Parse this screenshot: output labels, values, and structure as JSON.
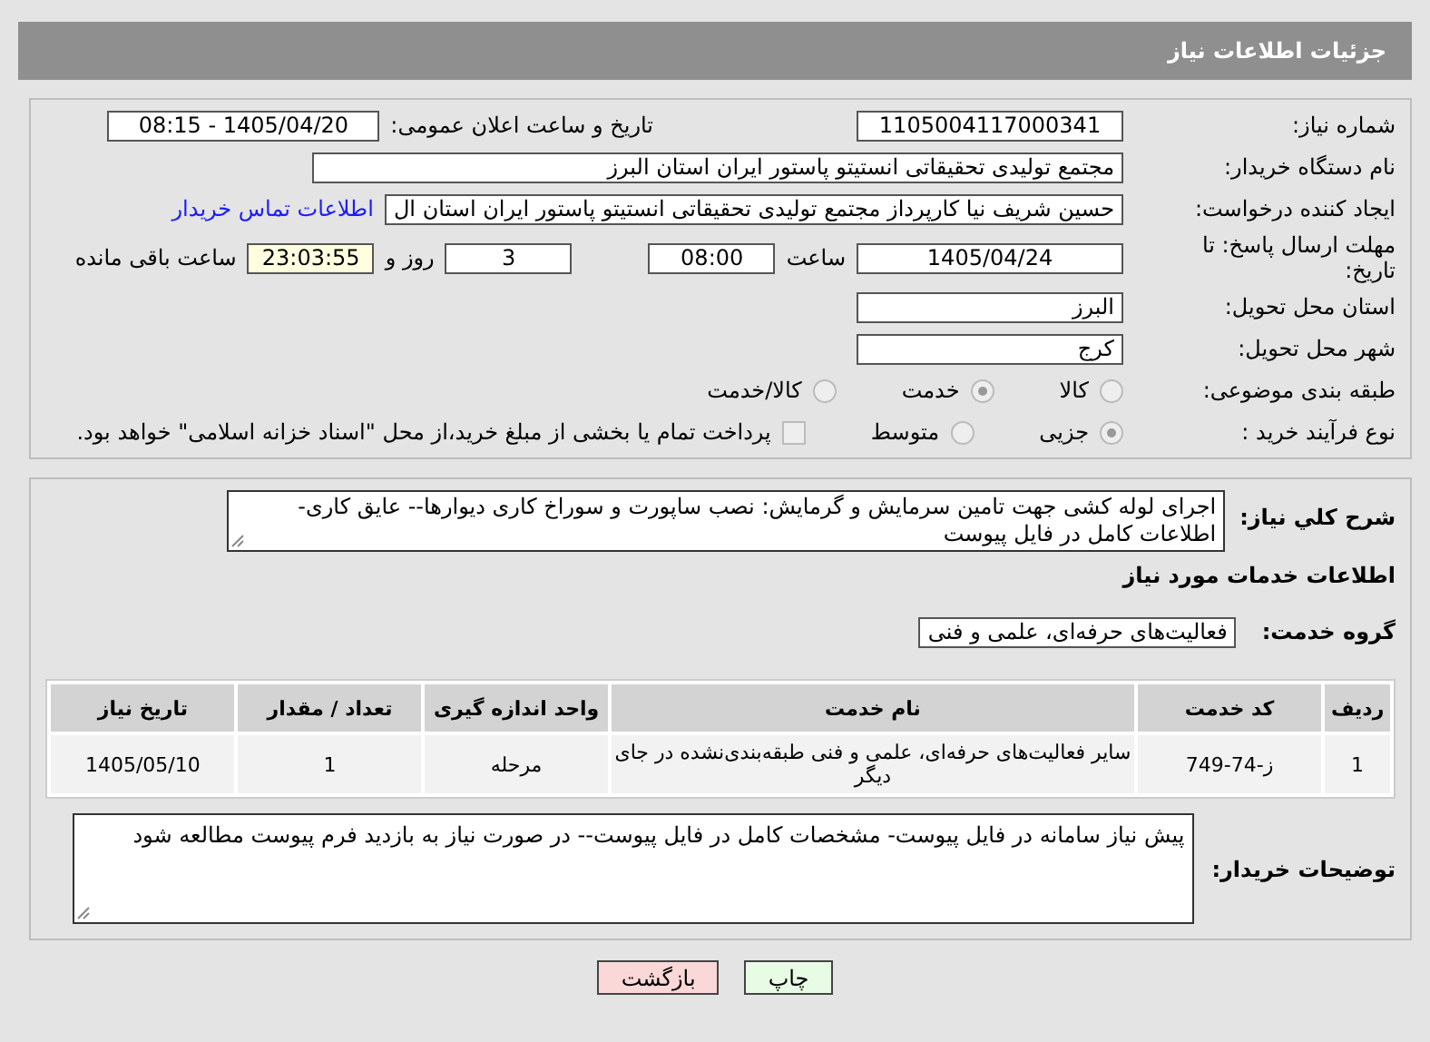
{
  "header": {
    "title": "جزئیات اطلاعات نیاز"
  },
  "need_number": {
    "label": "شماره نیاز:",
    "value": "1105004117000341"
  },
  "announce": {
    "label": "تاریخ و ساعت اعلان عمومی:",
    "value": "1405/04/20 - 08:15"
  },
  "buyer_org": {
    "label": "نام دستگاه خریدار:",
    "value": "مجتمع تولیدی تحقیقاتی انستیتو پاستور ایران استان البرز"
  },
  "requester": {
    "label": "ایجاد کننده درخواست:",
    "value": "حسین شریف نیا کارپرداز مجتمع تولیدی تحقیقاتی انستیتو پاستور ایران استان ال",
    "contact_link": "اطلاعات تماس خریدار"
  },
  "deadline": {
    "label": "مهلت ارسال پاسخ: تا تاریخ:",
    "date": "1405/04/24",
    "time_label": "ساعت",
    "time": "08:00",
    "days": "3",
    "days_label": "روز و",
    "remaining": "23:03:55",
    "remaining_label": "ساعت باقی مانده"
  },
  "province": {
    "label": "استان محل تحویل:",
    "value": "البرز"
  },
  "city": {
    "label": "شهر محل تحویل:",
    "value": "کرج"
  },
  "category": {
    "label": "طبقه بندی موضوعی:",
    "options": [
      {
        "label": "کالا",
        "selected": false
      },
      {
        "label": "خدمت",
        "selected": true
      },
      {
        "label": "کالا/خدمت",
        "selected": false
      }
    ]
  },
  "process": {
    "label": "نوع فرآیند خرید :",
    "options": [
      {
        "label": "جزیی",
        "selected": true
      },
      {
        "label": "متوسط",
        "selected": false
      }
    ],
    "treasury": {
      "checked": false,
      "text": "پرداخت تمام یا بخشی از مبلغ خرید،از محل \"اسناد خزانه اسلامی\" خواهد بود."
    }
  },
  "description": {
    "label": "شرح کلي نیاز:",
    "value": "اجرای لوله کشی جهت تامین سرمایش و گرمایش: نصب ساپورت و سوراخ کاری دیوارها-- عایق کاری- اطلاعات کامل در فایل پیوست"
  },
  "services_heading": "اطلاعات خدمات مورد نیاز",
  "service_group": {
    "label": "گروه خدمت:",
    "value": "فعالیت‌های حرفه‌ای، علمی و فنی"
  },
  "table": {
    "columns": [
      "ردیف",
      "کد خدمت",
      "نام خدمت",
      "واحد اندازه گیری",
      "تعداد / مقدار",
      "تاریخ نیاز"
    ],
    "rows": [
      [
        "1",
        "ز-74-749",
        "سایر فعالیت‌های حرفه‌ای، علمی و فنی طبقه‌بندی‌نشده در جای دیگر",
        "مرحله",
        "1",
        "1405/05/10"
      ]
    ]
  },
  "buyer_notes": {
    "label": "توضیحات خریدار:",
    "value": "پیش نیاز سامانه در فایل پیوست- مشخصات کامل در فایل پیوست-- در صورت نیاز به بازدید فرم پیوست مطالعه شود"
  },
  "buttons": [
    {
      "label": "چاپ",
      "kind": "print"
    },
    {
      "label": "بازگشت",
      "kind": "back"
    }
  ]
}
